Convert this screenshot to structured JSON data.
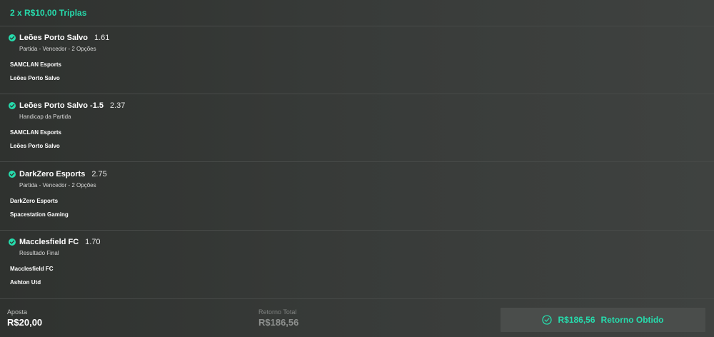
{
  "header": {
    "title": "2 x R$10,00 Triplas"
  },
  "selections": [
    {
      "name": "Leões Porto Salvo",
      "odds": "1.61",
      "market": "Partida - Vencedor - 2 Opções",
      "team1": "SAMCLAN Esports",
      "team2": "Leões Porto Salvo"
    },
    {
      "name": "Leões Porto Salvo -1.5",
      "odds": "2.37",
      "market": "Handicap da Partida",
      "team1": "SAMCLAN Esports",
      "team2": "Leões Porto Salvo"
    },
    {
      "name": "DarkZero Esports",
      "odds": "2.75",
      "market": "Partida - Vencedor - 2 Opções",
      "team1": "DarkZero Esports",
      "team2": "Spacestation Gaming"
    },
    {
      "name": "Macclesfield FC",
      "odds": "1.70",
      "market": "Resultado Final",
      "team1": "Macclesfield FC",
      "team2": "Ashton Utd"
    }
  ],
  "footer": {
    "stake_label": "Aposta",
    "stake_value": "R$20,00",
    "total_label": "Retorno Total",
    "total_value": "R$186,56",
    "cashout_amount": "R$186,56",
    "cashout_label": "Retorno Obtido"
  },
  "colors": {
    "accent": "#26dbac",
    "background": "#333634",
    "cashout_bg": "#4a4d4b"
  },
  "icons": {
    "selection_status": "check-circle-icon",
    "cashout_status": "check-circle-outline-icon"
  }
}
